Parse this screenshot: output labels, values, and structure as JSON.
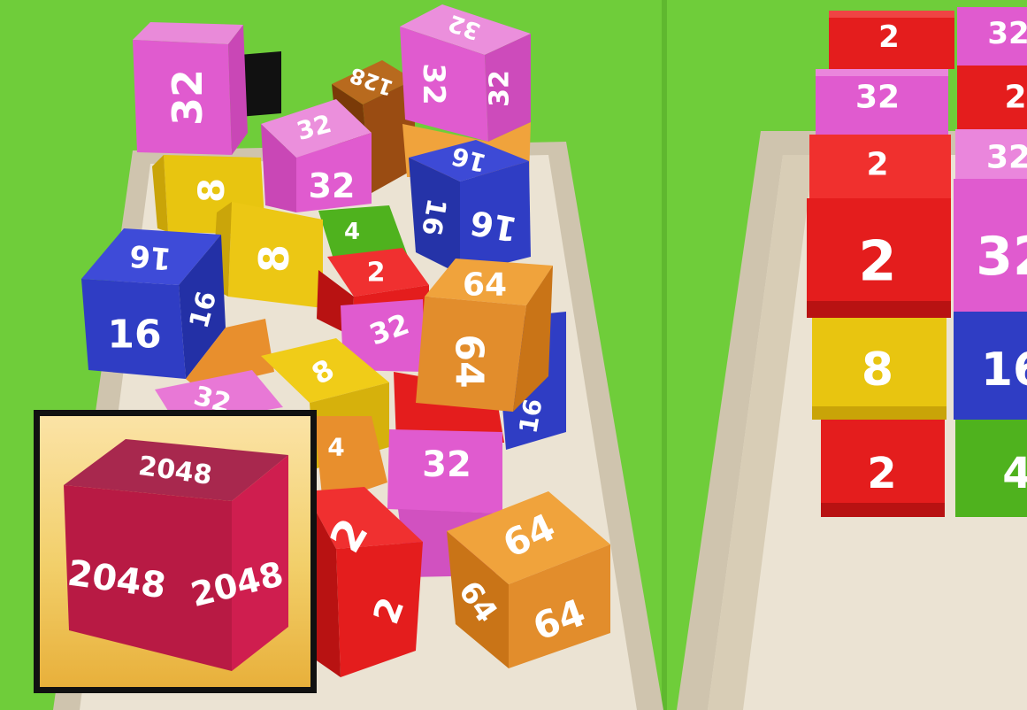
{
  "colors": {
    "background": "#6fcd3a",
    "track": "#e6dccb",
    "tile_2": "#e41d1d",
    "tile_4": "#4fb21e",
    "tile_8": "#e8c510",
    "tile_16": "#2f3dc4",
    "tile_32": "#e05bcf",
    "tile_64": "#e28d2c",
    "tile_128": "#9a4c12",
    "icon_cube": "#c21848",
    "icon_bg": "#f1c556"
  },
  "left_pile": [
    {
      "value": "32",
      "color": "pink"
    },
    {
      "value": "32",
      "color": "pink"
    },
    {
      "value": "32",
      "color": "pink"
    },
    {
      "value": "128",
      "color": "brown"
    },
    {
      "value": "16",
      "color": "blue"
    },
    {
      "value": "16",
      "color": "blue"
    },
    {
      "value": "8",
      "color": "yellow"
    },
    {
      "value": "8",
      "color": "yellow"
    },
    {
      "value": "8",
      "color": "yellow"
    },
    {
      "value": "4",
      "color": "green"
    },
    {
      "value": "4",
      "color": "orange"
    },
    {
      "value": "2",
      "color": "red"
    },
    {
      "value": "2",
      "color": "red"
    },
    {
      "value": "32",
      "color": "pink"
    },
    {
      "value": "32",
      "color": "pink"
    },
    {
      "value": "32",
      "color": "pink"
    },
    {
      "value": "64",
      "color": "orange"
    },
    {
      "value": "64",
      "color": "orange"
    },
    {
      "value": "16",
      "color": "blue"
    }
  ],
  "right_stack": {
    "left_column": [
      "2",
      "32",
      "2",
      "2",
      "8",
      "2"
    ],
    "right_column": [
      "32",
      "2",
      "32",
      "32",
      "16",
      "4"
    ]
  },
  "app_icon": {
    "cube_top": "2048",
    "cube_left": "2048",
    "cube_right": "2048"
  }
}
